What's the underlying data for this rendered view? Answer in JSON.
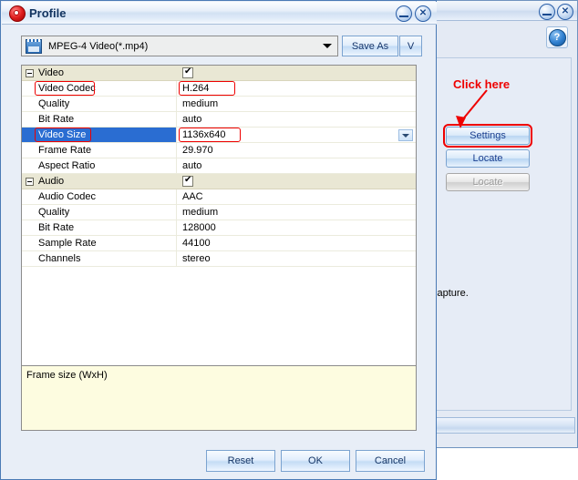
{
  "dialog": {
    "title": "Profile",
    "icon": "profile-target-icon",
    "minimize_label": "Minimize",
    "close_label": "Close",
    "profile_combo": {
      "value": "MPEG-4 Video(*.mp4)",
      "icon": "video-file-icon"
    },
    "save_as_label": "Save As",
    "v_label": "V",
    "description": "Frame size (WxH)",
    "buttons": {
      "reset": "Reset",
      "ok": "OK",
      "cancel": "Cancel"
    }
  },
  "grid": {
    "rows": [
      {
        "type": "category",
        "name": "Video",
        "value": "",
        "checkbox": true
      },
      {
        "type": "prop",
        "name": "Video Codec",
        "value": "H.264",
        "highlight_name": true,
        "highlight_value": true
      },
      {
        "type": "prop",
        "name": "Quality",
        "value": "medium"
      },
      {
        "type": "prop",
        "name": "Bit Rate",
        "value": "auto"
      },
      {
        "type": "prop",
        "name": "Video Size",
        "value": "1136x640",
        "selected": true,
        "highlight_name": true,
        "highlight_value": true,
        "dropdown": true
      },
      {
        "type": "prop",
        "name": "Frame Rate",
        "value": "29.970"
      },
      {
        "type": "prop",
        "name": "Aspect Ratio",
        "value": "auto"
      },
      {
        "type": "category",
        "name": "Audio",
        "value": "",
        "checkbox": true
      },
      {
        "type": "prop",
        "name": "Audio Codec",
        "value": "AAC"
      },
      {
        "type": "prop",
        "name": "Quality",
        "value": "medium"
      },
      {
        "type": "prop",
        "name": "Bit Rate",
        "value": "128000"
      },
      {
        "type": "prop",
        "name": "Sample Rate",
        "value": "44100"
      },
      {
        "type": "prop",
        "name": "Channels",
        "value": "stereo"
      }
    ]
  },
  "background_window": {
    "help_label": "?",
    "minimize_label": "Minimize",
    "close_label": "Close",
    "text_fragment": "capture.",
    "buttons": {
      "settings": "Settings",
      "locate": "Locate",
      "locate_disabled": "Locate"
    }
  },
  "annotation": {
    "click_here": "Click here",
    "color": "#ee0000"
  }
}
